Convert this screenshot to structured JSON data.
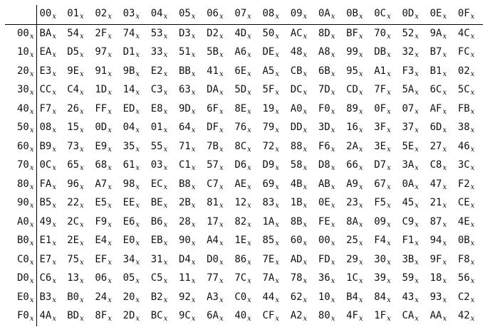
{
  "table": {
    "suffix": "x",
    "col_headers": [
      "00",
      "01",
      "02",
      "03",
      "04",
      "05",
      "06",
      "07",
      "08",
      "09",
      "0A",
      "0B",
      "0C",
      "0D",
      "0E",
      "0F"
    ],
    "row_headers": [
      "00",
      "10",
      "20",
      "30",
      "40",
      "50",
      "60",
      "70",
      "80",
      "90",
      "A0",
      "B0",
      "C0",
      "D0",
      "E0",
      "F0"
    ],
    "rows": [
      [
        "BA",
        "54",
        "2F",
        "74",
        "53",
        "D3",
        "D2",
        "4D",
        "50",
        "AC",
        "8D",
        "BF",
        "70",
        "52",
        "9A",
        "4C"
      ],
      [
        "EA",
        "D5",
        "97",
        "D1",
        "33",
        "51",
        "5B",
        "A6",
        "DE",
        "48",
        "A8",
        "99",
        "DB",
        "32",
        "B7",
        "FC"
      ],
      [
        "E3",
        "9E",
        "91",
        "9B",
        "E2",
        "BB",
        "41",
        "6E",
        "A5",
        "CB",
        "6B",
        "95",
        "A1",
        "F3",
        "B1",
        "02"
      ],
      [
        "CC",
        "C4",
        "1D",
        "14",
        "C3",
        "63",
        "DA",
        "5D",
        "5F",
        "DC",
        "7D",
        "CD",
        "7F",
        "5A",
        "6C",
        "5C"
      ],
      [
        "F7",
        "26",
        "FF",
        "ED",
        "E8",
        "9D",
        "6F",
        "8E",
        "19",
        "A0",
        "F0",
        "89",
        "0F",
        "07",
        "AF",
        "FB"
      ],
      [
        "08",
        "15",
        "0D",
        "04",
        "01",
        "64",
        "DF",
        "76",
        "79",
        "DD",
        "3D",
        "16",
        "3F",
        "37",
        "6D",
        "38"
      ],
      [
        "B9",
        "73",
        "E9",
        "35",
        "55",
        "71",
        "7B",
        "8C",
        "72",
        "88",
        "F6",
        "2A",
        "3E",
        "5E",
        "27",
        "46"
      ],
      [
        "0C",
        "65",
        "68",
        "61",
        "03",
        "C1",
        "57",
        "D6",
        "D9",
        "58",
        "D8",
        "66",
        "D7",
        "3A",
        "C8",
        "3C"
      ],
      [
        "FA",
        "96",
        "A7",
        "98",
        "EC",
        "B8",
        "C7",
        "AE",
        "69",
        "4B",
        "AB",
        "A9",
        "67",
        "0A",
        "47",
        "F2"
      ],
      [
        "B5",
        "22",
        "E5",
        "EE",
        "BE",
        "2B",
        "81",
        "12",
        "83",
        "1B",
        "0E",
        "23",
        "F5",
        "45",
        "21",
        "CE"
      ],
      [
        "49",
        "2C",
        "F9",
        "E6",
        "B6",
        "28",
        "17",
        "82",
        "1A",
        "8B",
        "FE",
        "8A",
        "09",
        "C9",
        "87",
        "4E"
      ],
      [
        "E1",
        "2E",
        "E4",
        "E0",
        "EB",
        "90",
        "A4",
        "1E",
        "85",
        "60",
        "00",
        "25",
        "F4",
        "F1",
        "94",
        "0B"
      ],
      [
        "E7",
        "75",
        "EF",
        "34",
        "31",
        "D4",
        "D0",
        "86",
        "7E",
        "AD",
        "FD",
        "29",
        "30",
        "3B",
        "9F",
        "F8"
      ],
      [
        "C6",
        "13",
        "06",
        "05",
        "C5",
        "11",
        "77",
        "7C",
        "7A",
        "78",
        "36",
        "1C",
        "39",
        "59",
        "18",
        "56"
      ],
      [
        "B3",
        "B0",
        "24",
        "20",
        "B2",
        "92",
        "A3",
        "C0",
        "44",
        "62",
        "10",
        "B4",
        "84",
        "43",
        "93",
        "C2"
      ],
      [
        "4A",
        "BD",
        "8F",
        "2D",
        "BC",
        "9C",
        "6A",
        "40",
        "CF",
        "A2",
        "80",
        "4F",
        "1F",
        "CA",
        "AA",
        "42"
      ]
    ]
  }
}
